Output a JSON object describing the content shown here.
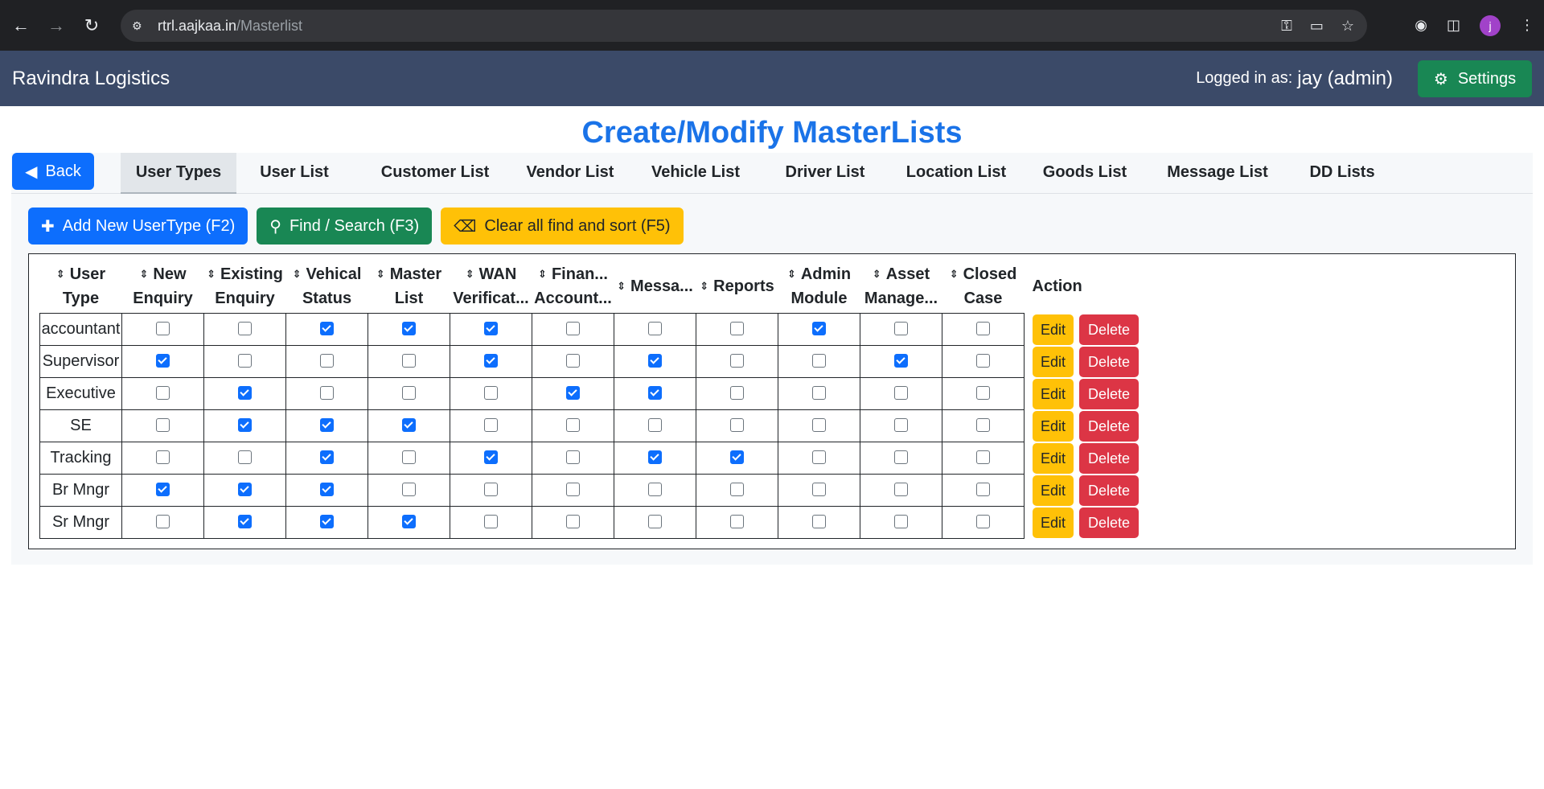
{
  "browser": {
    "url_host": "rtrl.aajkaa.in",
    "url_path": "/Masterlist",
    "avatar_letter": "j"
  },
  "app": {
    "brand": "Ravindra Logistics",
    "logged_in_label": "Logged in as:",
    "logged_in_user": "jay (admin)",
    "settings_label": "Settings"
  },
  "page": {
    "title": "Create/Modify MasterLists",
    "back_label": "Back"
  },
  "tabs": [
    {
      "label": "User Types",
      "active": true
    },
    {
      "label": "User List"
    },
    {
      "label": "Customer List"
    },
    {
      "label": "Vendor List"
    },
    {
      "label": "Vehicle List"
    },
    {
      "label": "Driver List"
    },
    {
      "label": "Location List"
    },
    {
      "label": "Goods List"
    },
    {
      "label": "Message List"
    },
    {
      "label": "DD Lists"
    }
  ],
  "toolbar": {
    "add_label": "Add New UserType (F2)",
    "find_label": "Find / Search (F3)",
    "clear_label": "Clear all find and sort (F5)"
  },
  "table": {
    "headers": [
      [
        "User",
        "Type"
      ],
      [
        "New",
        "Enquiry"
      ],
      [
        "Existing",
        "Enquiry"
      ],
      [
        "Vehical",
        "Status"
      ],
      [
        "Master",
        "List"
      ],
      [
        "WAN",
        "Verificat..."
      ],
      [
        "Finan...",
        "Account..."
      ],
      [
        "Messa..."
      ],
      [
        "Reports"
      ],
      [
        "Admin",
        "Module"
      ],
      [
        "Asset",
        "Manage..."
      ],
      [
        "Closed",
        "Case"
      ]
    ],
    "action_header": "Action",
    "edit_label": "Edit",
    "delete_label": "Delete",
    "rows": [
      {
        "name": "accountant",
        "flags": [
          false,
          false,
          true,
          true,
          true,
          false,
          false,
          false,
          true,
          false,
          false
        ]
      },
      {
        "name": "Supervisor",
        "flags": [
          true,
          false,
          false,
          false,
          true,
          false,
          true,
          false,
          false,
          true,
          false
        ]
      },
      {
        "name": "Executive",
        "flags": [
          false,
          true,
          false,
          false,
          false,
          true,
          true,
          false,
          false,
          false,
          false
        ]
      },
      {
        "name": "SE",
        "flags": [
          false,
          true,
          true,
          true,
          false,
          false,
          false,
          false,
          false,
          false,
          false
        ]
      },
      {
        "name": "Tracking",
        "flags": [
          false,
          false,
          true,
          false,
          true,
          false,
          true,
          true,
          false,
          false,
          false
        ]
      },
      {
        "name": "Br Mngr",
        "flags": [
          true,
          true,
          true,
          false,
          false,
          false,
          false,
          false,
          false,
          false,
          false
        ]
      },
      {
        "name": "Sr Mngr",
        "flags": [
          false,
          true,
          true,
          true,
          false,
          false,
          false,
          false,
          false,
          false,
          false
        ]
      }
    ]
  },
  "colors": {
    "header_bg": "#3b4a68",
    "primary": "#0d6efd",
    "success": "#198754",
    "warning": "#ffc107",
    "danger": "#dc3545",
    "title": "#1a73e8"
  }
}
